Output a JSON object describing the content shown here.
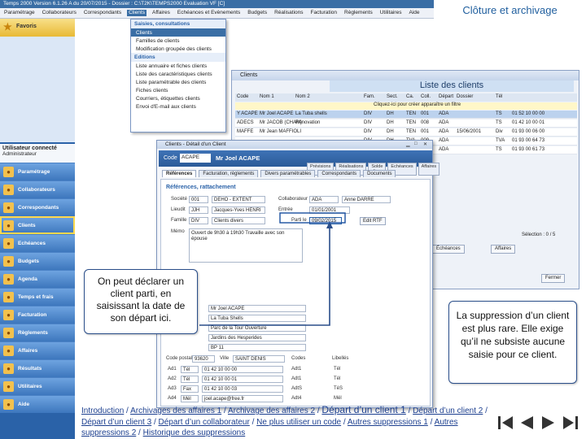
{
  "corner_title": "Clôture et archivage",
  "app": {
    "title": "Temps 2000 Version 6.1.26 A du 20/07/2015 - Dossier : C:\\T2K\\TEMPS2000 Evaluation VF [C]",
    "menu": [
      "Paramétrage",
      "Collaborateurs",
      "Correspondants",
      "Clients",
      "Affaires",
      "Echéances et Evènements",
      "Budgets",
      "Réalisations",
      "Facturation",
      "Règlements",
      "Utilitaires",
      "Aide"
    ]
  },
  "leftnav": {
    "favorites": "Favoris",
    "user_title": "Utilisateur connecté",
    "user_name": "Administrateur",
    "items": [
      {
        "label": "Paramétrage",
        "icon": "tools-icon"
      },
      {
        "label": "Collaborateurs",
        "icon": "people-icon"
      },
      {
        "label": "Correspondants",
        "icon": "contacts-icon"
      },
      {
        "label": "Clients",
        "icon": "clients-icon"
      },
      {
        "label": "Echéances",
        "icon": "calendar-icon"
      },
      {
        "label": "Budgets",
        "icon": "budget-icon"
      },
      {
        "label": "Agenda",
        "icon": "agenda-icon"
      },
      {
        "label": "Temps et frais",
        "icon": "clock-icon"
      },
      {
        "label": "Facturation",
        "icon": "invoice-icon"
      },
      {
        "label": "Règlements",
        "icon": "payment-icon"
      },
      {
        "label": "Affaires",
        "icon": "folder-icon"
      },
      {
        "label": "Résultats",
        "icon": "chart-icon"
      },
      {
        "label": "Utilitaires",
        "icon": "utility-icon"
      },
      {
        "label": "Aide",
        "icon": "help-icon"
      }
    ]
  },
  "dropdown": {
    "head1": "Saisies, consultations",
    "items1": [
      "Clients",
      "Familles de clients",
      "Modification groupée des clients"
    ],
    "head2": "Editions",
    "items2": [
      "Liste annuaire et fiches clients",
      "Liste des caractéristiques clients",
      "Liste paramétrable des clients",
      "Fiches clients",
      "Courriers, étiquettes clients",
      "Envoi d'E-mail aux clients"
    ]
  },
  "clients_window": {
    "title": "Clients",
    "banner": "Liste des clients",
    "columns": [
      "Code",
      "Nom 1",
      "Nom 2",
      "Fam.",
      "Sect.",
      "Ca.",
      "Coll.",
      "Départ",
      "Dossier",
      "Tél"
    ],
    "hint": "Cliquez-ici pour créer apparaître un filtre",
    "rows": [
      [
        "Y ACAPE",
        "Mr Joel ACAPE",
        "La Tuba shells",
        "DIV",
        "DH",
        "TEN",
        "001",
        "ADA",
        "",
        "TS",
        "01 52 10 00 00"
      ],
      [
        "ADECS",
        "Mr JACOB (CHAM)",
        "Rénovation",
        "DIV",
        "DH",
        "TEN",
        "008",
        "ADA",
        "",
        "TS",
        "01 42 10 00 01"
      ],
      [
        "MAFFE",
        "Mr Jean MAFFIOLI",
        "",
        "DIV",
        "DH",
        "TEN",
        "001",
        "ADA",
        "15/06/2001",
        "Div",
        "01 93 00 06 00"
      ],
      [
        "",
        "",
        "",
        "DIV",
        "DH",
        "TVA",
        "009",
        "ADA",
        "",
        "TVA",
        "01 93 00 64 73"
      ],
      [
        "",
        "",
        "",
        "DIV",
        "DH",
        "TEN",
        "001",
        "ADA",
        "",
        "TS",
        "01 93 00 61 73"
      ]
    ],
    "right_tab1": "Échéances",
    "right_tab2": "Affaires",
    "selection": "Sélection : 0 / 5",
    "close_label": "Fermer"
  },
  "detail_window": {
    "title": "Clients - Détail d'un Client",
    "code_label": "Code",
    "code_value": "ACAPE",
    "client_name": "Mr Joel ACAPE",
    "top_tabs": [
      "Prévisions",
      "Réalisations",
      "Solde cli.",
      "Echéances",
      "Affaires"
    ],
    "tabs": [
      "Références",
      "Facturation, règlements",
      "Divers paramétrables",
      "Correspondants",
      "Documents"
    ],
    "section": "Références, rattachement",
    "fields": {
      "societe_label": "Société",
      "societe_value": "001",
      "societe_desc": "DEHO - EXTENT",
      "collab_label": "Collaborateur",
      "collab_value": "ADA",
      "collab_desc": "Anne DARRE",
      "lieudit_label": "Lieudit",
      "lieudit_value": "JJH",
      "lieudit_desc": "Jacques-Yves HENRI",
      "entree_label": "Entrée",
      "entree_value": "01/01/2001",
      "famille_label": "Famille",
      "famille_value": "DIV",
      "famille_desc": "Clients divers",
      "partie_label": "Parti le",
      "partie_value": "09/02/2015",
      "btn_rtf": "Edit RTF",
      "memo_label": "Mémo",
      "memo_text": "Ouvert de 9h30 à 19h30 Travaille avec son épouse"
    },
    "address": {
      "line1": "Mr Joel ACAPE",
      "line2": "La Tuba Shells",
      "line3": "Parc de la Tour Ouverture",
      "line4": "Jardins des Hesperides",
      "line5": "BP 11",
      "cp_label": "Code postal",
      "cp_value": "93620",
      "ville_label": "Ville",
      "ville_value": "SAINT DENIS",
      "codes_label": "Codes",
      "codes_value": "Libellés"
    },
    "phones": [
      {
        "label": "Ad1",
        "type": "Tél",
        "value": "01 42 10 00 00",
        "code": "Adt1",
        "lib": "Tél"
      },
      {
        "label": "Ad2",
        "type": "Tél",
        "value": "01 42 10 00 01",
        "code": "Adt1",
        "lib": "Tél"
      },
      {
        "label": "Ad3",
        "type": "Fax",
        "value": "01 42 10 00 03",
        "code": "AdtS",
        "lib": "TéS"
      },
      {
        "label": "Ad4",
        "type": "Mél",
        "value": "joel.acape@free.fr",
        "code": "Adt4",
        "lib": "Mél"
      }
    ]
  },
  "callouts": {
    "left": "On peut déclarer un client parti, en saisissant la date de son départ ici.",
    "right": "La suppression d’un client est plus rare. Elle exige qu’il ne subsiste aucune saisie pour ce client."
  },
  "footer_links": [
    {
      "label": "Introduction",
      "sep": " / "
    },
    {
      "label": "Archivages des affaires 1",
      "sep": " / "
    },
    {
      "label": "Archivage des affaires 2",
      "sep": " / "
    },
    {
      "label": "Départ d’un client 1",
      "sep": " / ",
      "current": true
    },
    {
      "label": "Départ d’un client 2",
      "sep": " / "
    },
    {
      "label": "Départ d’un client 3",
      "sep": " / "
    },
    {
      "label": "Départ d’un collaborateur",
      "sep": " / "
    },
    {
      "label": "Ne plus utiliser un code",
      "sep": " / "
    },
    {
      "label": "Autres suppressions 1",
      "sep": " / "
    },
    {
      "label": "Autres suppressions 2",
      "sep": " / "
    },
    {
      "label": "Historique des suppressions",
      "sep": ""
    }
  ],
  "nav_buttons": [
    "first-slide-icon",
    "previous-slide-icon",
    "next-slide-icon",
    "last-slide-icon"
  ]
}
